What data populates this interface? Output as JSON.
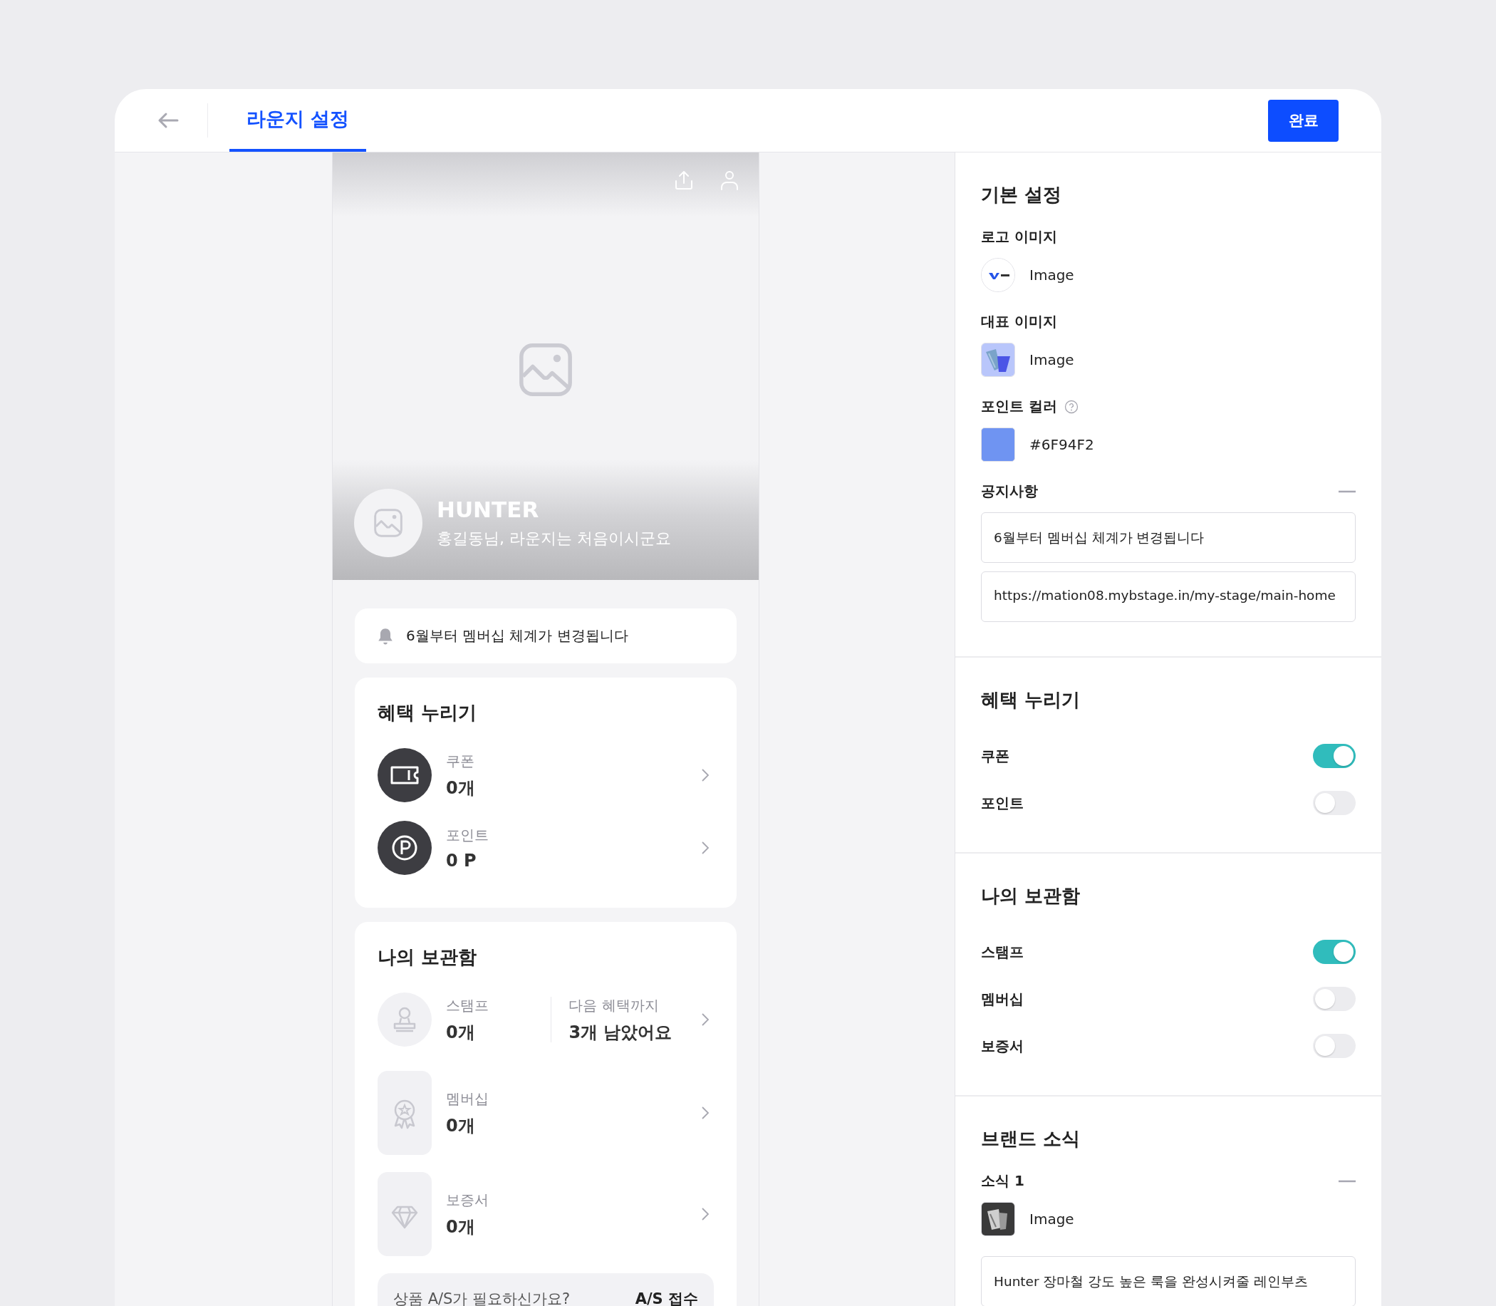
{
  "header": {
    "tabs": [
      {
        "label": "라운지 설정",
        "selected": true
      }
    ],
    "done_button": "완료"
  },
  "preview": {
    "hero": {
      "brand": "HUNTER",
      "greeting": "홍길동님, 라운지는 처음이시군요"
    },
    "notice": "6월부터 멤버십 체계가 변경됩니다",
    "benefits": {
      "title": "혜택 누리기",
      "items": [
        {
          "label": "쿠폰",
          "value": "0개"
        },
        {
          "label": "포인트",
          "value": "0 P"
        }
      ]
    },
    "storage": {
      "title": "나의 보관함",
      "items": [
        {
          "label": "스탬프",
          "value": "0개",
          "extra_label": "다음 혜택까지",
          "extra_value": "3개 남았어요"
        },
        {
          "label": "멤버십",
          "value": "0개"
        },
        {
          "label": "보증서",
          "value": "0개"
        }
      ],
      "as_banner": {
        "text": "상품 A/S가 필요하신가요?",
        "action": "A/S 접수"
      }
    }
  },
  "settings": {
    "basic": {
      "title": "기본 설정",
      "logo": {
        "label": "로고 이미지",
        "value": "Image"
      },
      "main_image": {
        "label": "대표 이미지",
        "value": "Image"
      },
      "point_color": {
        "label": "포인트 컬러",
        "value": "#6F94F2",
        "color": "#6f94f2"
      },
      "notice": {
        "label": "공지사항",
        "fields": [
          "6월부터 멤버십 체계가 변경됩니다",
          "https://mation08.mybstage.in/my-stage/main-home"
        ]
      }
    },
    "toggle_sections": [
      {
        "title": "혜택 누리기",
        "items": [
          {
            "label": "쿠폰",
            "on": true
          },
          {
            "label": "포인트",
            "on": false
          }
        ]
      },
      {
        "title": "나의 보관함",
        "items": [
          {
            "label": "스탬프",
            "on": true
          },
          {
            "label": "멤버십",
            "on": false
          },
          {
            "label": "보증서",
            "on": false
          }
        ]
      }
    ],
    "brand_news": {
      "title": "브랜드 소식",
      "items": [
        {
          "label": "소식 1",
          "image": "Image",
          "text": "Hunter 장마철 강도 높은 룩을 완성시켜줄 레인부츠"
        }
      ]
    }
  }
}
